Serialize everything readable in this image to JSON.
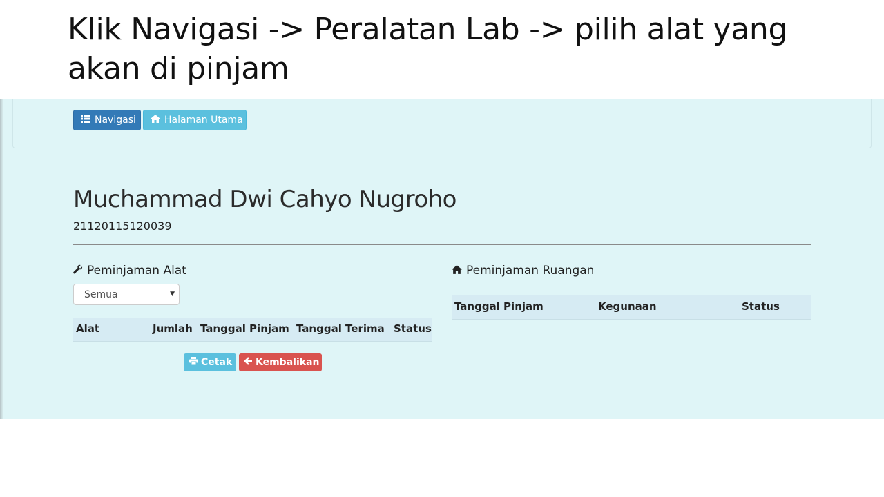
{
  "slide": {
    "title": "Klik Navigasi -> Peralatan Lab -> pilih alat yang akan di pinjam"
  },
  "navbar": {
    "nav_button": "Navigasi",
    "home_button": "Halaman Utama"
  },
  "profile": {
    "name": "Muchammad Dwi Cahyo Nugroho",
    "id": "21120115120039"
  },
  "peminjaman_alat": {
    "title": "Peminjaman Alat",
    "filter_selected": "Semua",
    "columns": [
      "Alat",
      "Jumlah",
      "Tanggal Pinjam",
      "Tanggal Terima",
      "Status"
    ],
    "print_button": "Cetak",
    "return_button": "Kembalikan"
  },
  "peminjaman_ruangan": {
    "title": "Peminjaman Ruangan",
    "columns": [
      "Tanggal Pinjam",
      "Kegunaan",
      "Status"
    ]
  },
  "colors": {
    "primary": "#337ab7",
    "info": "#5bc0de",
    "danger": "#d9534f",
    "background": "#dff5f7"
  }
}
